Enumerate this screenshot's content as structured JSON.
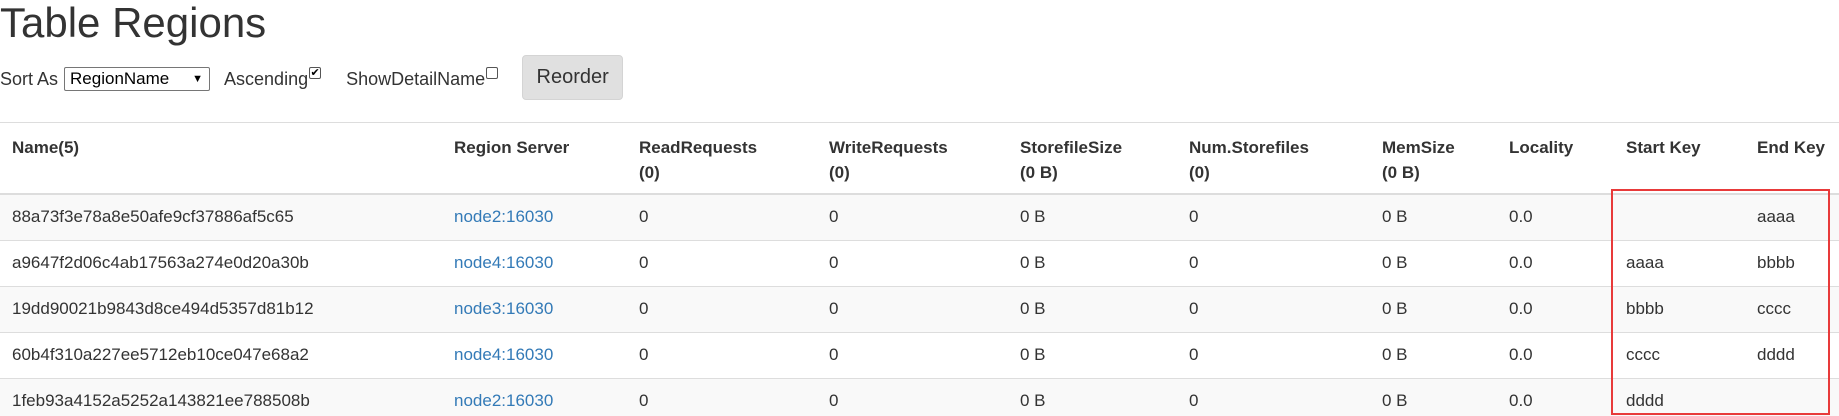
{
  "page": {
    "title": "Table Regions"
  },
  "controls": {
    "sort_as_label": "Sort As",
    "sort_as_selected": "RegionName",
    "ascending_label": "Ascending",
    "ascending_checked": true,
    "show_detail_label": "ShowDetailName",
    "show_detail_checked": false,
    "reorder_label": "Reorder"
  },
  "table": {
    "headers": [
      [
        "Name(5)",
        ""
      ],
      [
        "Region Server",
        ""
      ],
      [
        "ReadRequests",
        "(0)"
      ],
      [
        "WriteRequests",
        "(0)"
      ],
      [
        "StorefileSize",
        "(0 B)"
      ],
      [
        "Num.Storefiles",
        "(0)"
      ],
      [
        "MemSize",
        "(0 B)"
      ],
      [
        "Locality",
        ""
      ],
      [
        "Start Key",
        ""
      ],
      [
        "End Key",
        ""
      ]
    ],
    "rows": [
      [
        "88a73f3e78a8e50afe9cf37886af5c65",
        "node2:16030",
        "0",
        "0",
        "0 B",
        "0",
        "0 B",
        "0.0",
        "",
        "aaaa"
      ],
      [
        "a9647f2d06c4ab17563a274e0d20a30b",
        "node4:16030",
        "0",
        "0",
        "0 B",
        "0",
        "0 B",
        "0.0",
        "aaaa",
        "bbbb"
      ],
      [
        "19dd90021b9843d8ce494d5357d81b12",
        "node3:16030",
        "0",
        "0",
        "0 B",
        "0",
        "0 B",
        "0.0",
        "bbbb",
        "cccc"
      ],
      [
        "60b4f310a227ee5712eb10ce047e68a2",
        "node4:16030",
        "0",
        "0",
        "0 B",
        "0",
        "0 B",
        "0.0",
        "cccc",
        "dddd"
      ],
      [
        "1feb93a4152a5252a143821ee788508b",
        "node2:16030",
        "0",
        "0",
        "0 B",
        "0",
        "0 B",
        "0.0",
        "dddd",
        ""
      ]
    ]
  },
  "colors": {
    "link": "#337ab7",
    "highlight": "#e83a3a",
    "button_bg": "#e0e0e0",
    "row_stripe": "#f9f9f9"
  }
}
